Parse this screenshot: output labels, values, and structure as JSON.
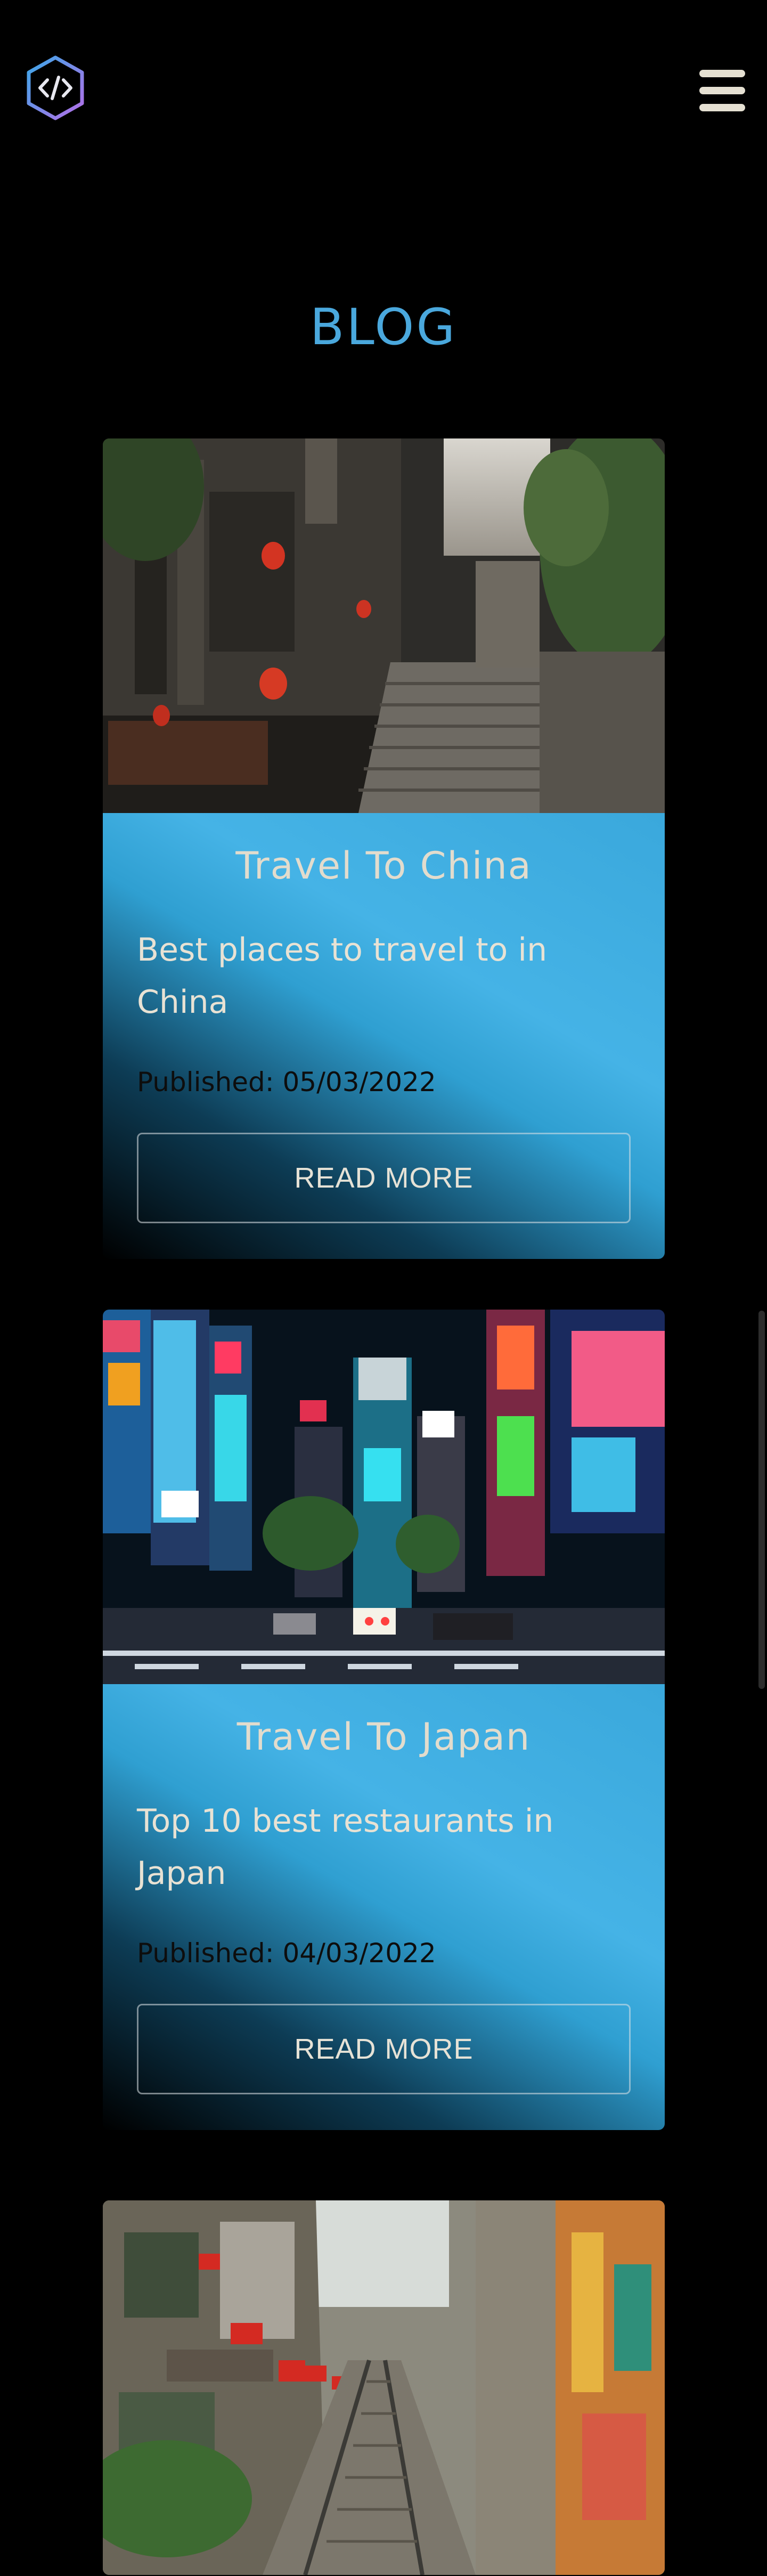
{
  "header": {
    "logo_icon": "code-hexagon-icon",
    "menu_icon": "hamburger-menu-icon"
  },
  "page": {
    "title": "BLOG"
  },
  "posts": [
    {
      "title": "Travel To China",
      "description": "Best places to travel to in China",
      "published": "Published: 05/03/2022",
      "button_label": "READ MORE",
      "image_alt": "China street with red lanterns and stairs"
    },
    {
      "title": "Travel To Japan",
      "description": "Top 10 best restaurants in Japan",
      "published": "Published: 04/03/2022",
      "button_label": "READ MORE",
      "image_alt": "Tokyo Shibuya neon night street"
    },
    {
      "image_alt": "Hanoi train street with flags"
    }
  ],
  "colors": {
    "accent": "#4aa8dd",
    "card_gradient_light": "#45b3e6",
    "background": "#000000",
    "button_text": "#e6e2d6"
  }
}
